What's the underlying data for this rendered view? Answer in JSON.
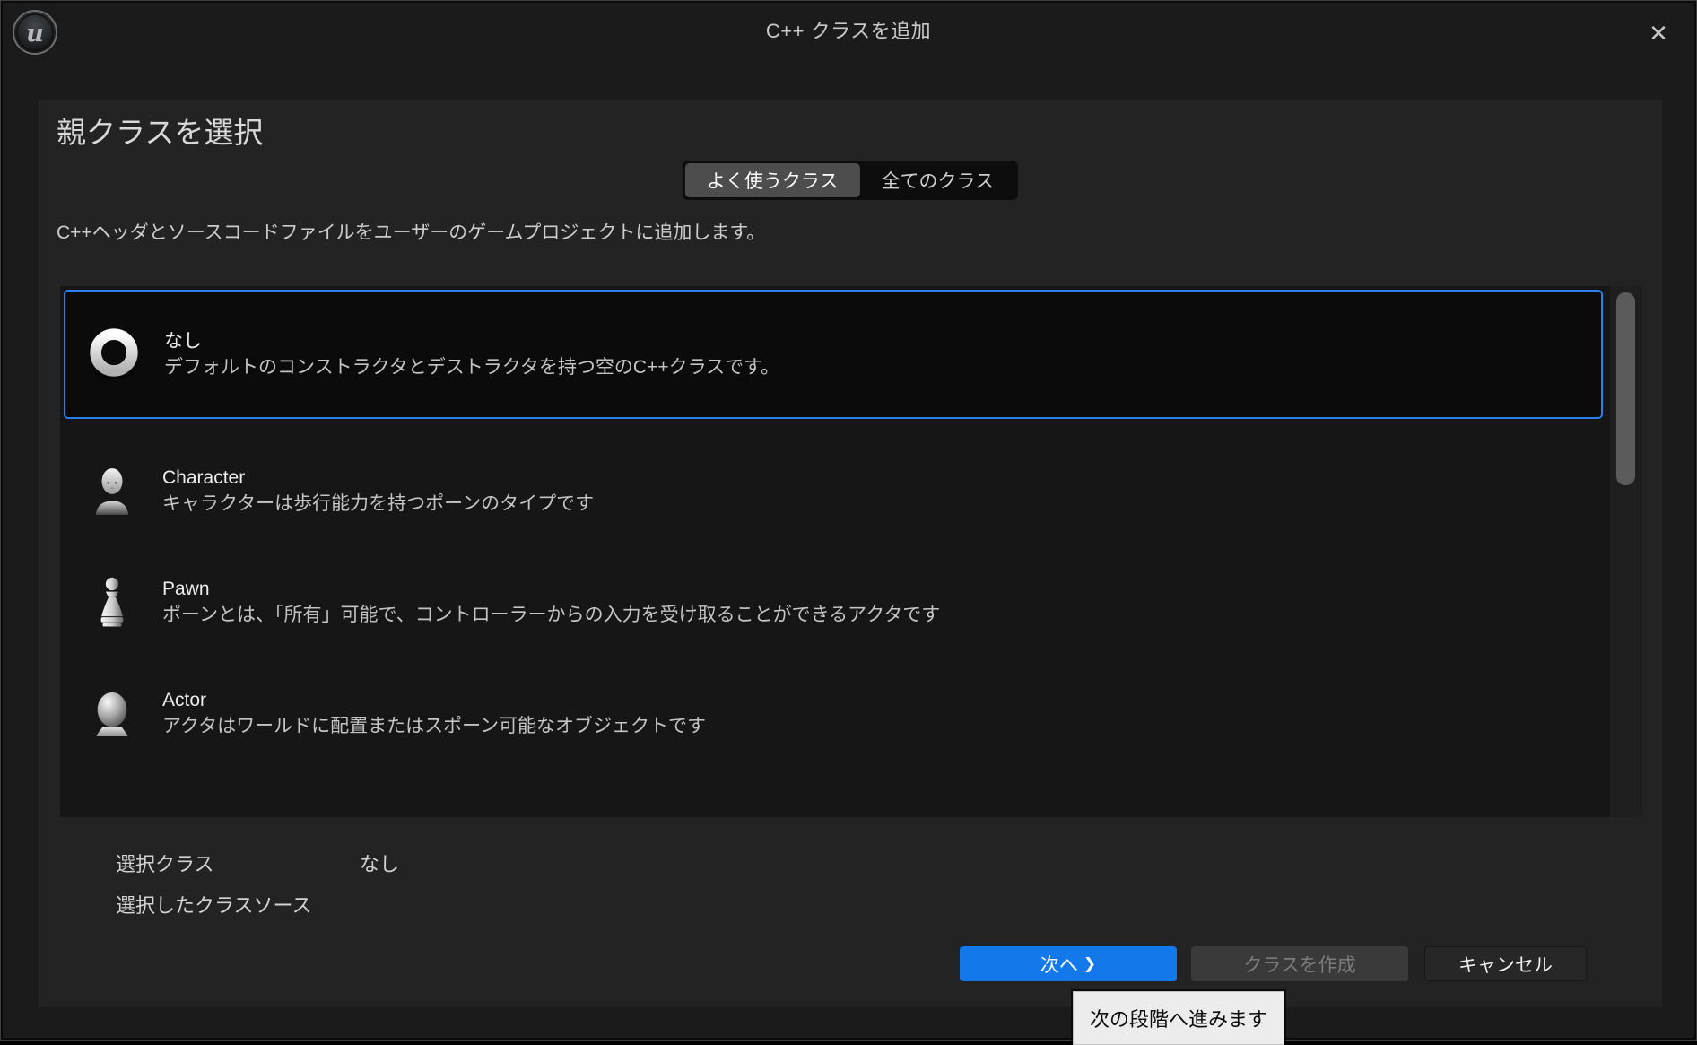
{
  "window": {
    "title": "C++ クラスを追加",
    "close_glyph": "✕"
  },
  "panel": {
    "heading": "親クラスを選択",
    "tabs": [
      {
        "label": "よく使うクラス",
        "selected": true
      },
      {
        "label": "全てのクラス",
        "selected": false
      }
    ],
    "description": "C++ヘッダとソースコードファイルをユーザーのゲームプロジェクトに追加します。",
    "classes": [
      {
        "name": "なし",
        "description": "デフォルトのコンストラクタとデストラクタを持つ空のC++クラスです。",
        "icon": "empty-class-ring-icon",
        "selected": true
      },
      {
        "name": "Character",
        "description": "キャラクターは歩行能力を持つポーンのタイプです",
        "icon": "character-icon",
        "selected": false
      },
      {
        "name": "Pawn",
        "description": "ポーンとは、「所有」可能で、コントローラーからの入力を受け取ることができるアクタです",
        "icon": "pawn-icon",
        "selected": false
      },
      {
        "name": "Actor",
        "description": "アクタはワールドに配置またはスポーン可能なオブジェクトです",
        "icon": "actor-icon",
        "selected": false
      }
    ],
    "summary": {
      "selected_class_label": "選択クラス",
      "selected_class_value": "なし",
      "selected_source_label": "選択したクラスソース"
    },
    "buttons": {
      "next": "次へ",
      "next_chevron": "❯",
      "create": "クラスを作成",
      "cancel": "キャンセル"
    }
  },
  "tooltip": {
    "text": "次の段階へ進みます"
  },
  "colors": {
    "accent_blue": "#1379ea",
    "selection_border": "#2a80e8",
    "panel_bg": "#232323",
    "list_bg": "#161616",
    "window_bg": "#1b1b1b",
    "tooltip_bg": "#ececec"
  }
}
